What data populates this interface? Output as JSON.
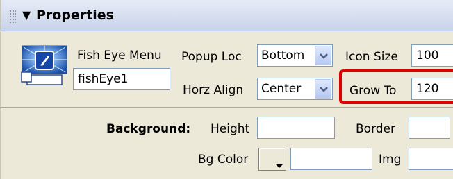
{
  "panel": {
    "title": "Properties",
    "collapse_icon": "triangle-down-icon"
  },
  "component": {
    "type_label": "Fish Eye Menu",
    "id_value": "fishEye1",
    "icon": "fisheye-menu-icon"
  },
  "popup_loc": {
    "label": "Popup Loc",
    "value": "Bottom"
  },
  "horz_align": {
    "label": "Horz Align",
    "value": "Center"
  },
  "icon_size": {
    "label": "Icon Size",
    "value": "100"
  },
  "grow_to": {
    "label": "Grow To",
    "value": "120"
  },
  "background": {
    "section_label": "Background:",
    "height_label": "Height",
    "height_value": "",
    "border_label": "Border",
    "border_value": "",
    "bgcolor_label": "Bg Color",
    "bgcolor_value": "",
    "img_label": "Img",
    "img_value": ""
  },
  "colors": {
    "highlight": "#e00000",
    "panel_bg": "#ece9d8",
    "titlebar": "#c9d3ea"
  }
}
